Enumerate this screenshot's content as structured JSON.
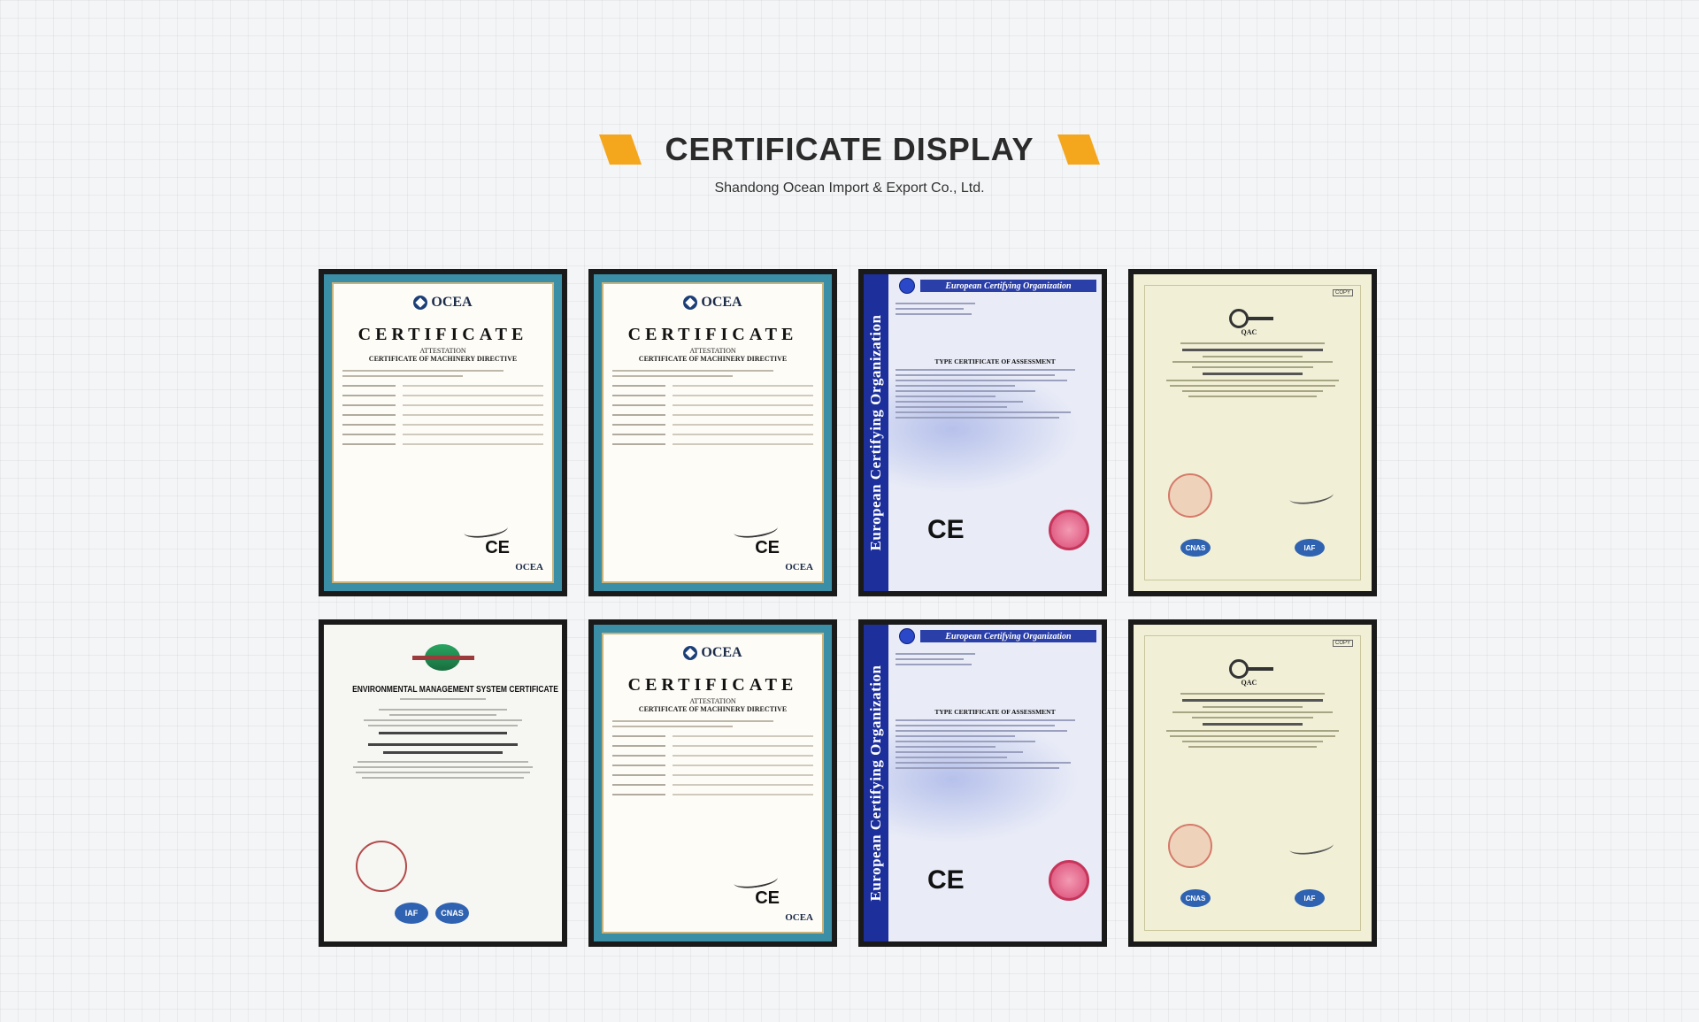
{
  "heading": {
    "title": "CERTIFICATE DISPLAY",
    "subtitle": "Shandong Ocean Import & Export Co., Ltd.",
    "accent_color": "#f4a61d"
  },
  "ocea": {
    "logo": "OCEA",
    "word": "CERTIFICATE",
    "attestation": "ATTESTATION",
    "subtitle": "CERTIFICATE OF MACHINERY DIRECTIVE",
    "ce": "CE",
    "foot_logo": "OCEA"
  },
  "eco": {
    "side": "European Certifying Organization",
    "org": "European Certifying Organization",
    "title": "TYPE CERTIFICATE OF ASSESSMENT",
    "ce": "CE"
  },
  "qac": {
    "copy": "COPY",
    "logo": "QAC",
    "badge1": "CNAS",
    "badge2": "IAF"
  },
  "ccci": {
    "title": "ENVIRONMENTAL MANAGEMENT SYSTEM CERTIFICATE",
    "badge1": "IAF",
    "badge2": "CNAS"
  }
}
